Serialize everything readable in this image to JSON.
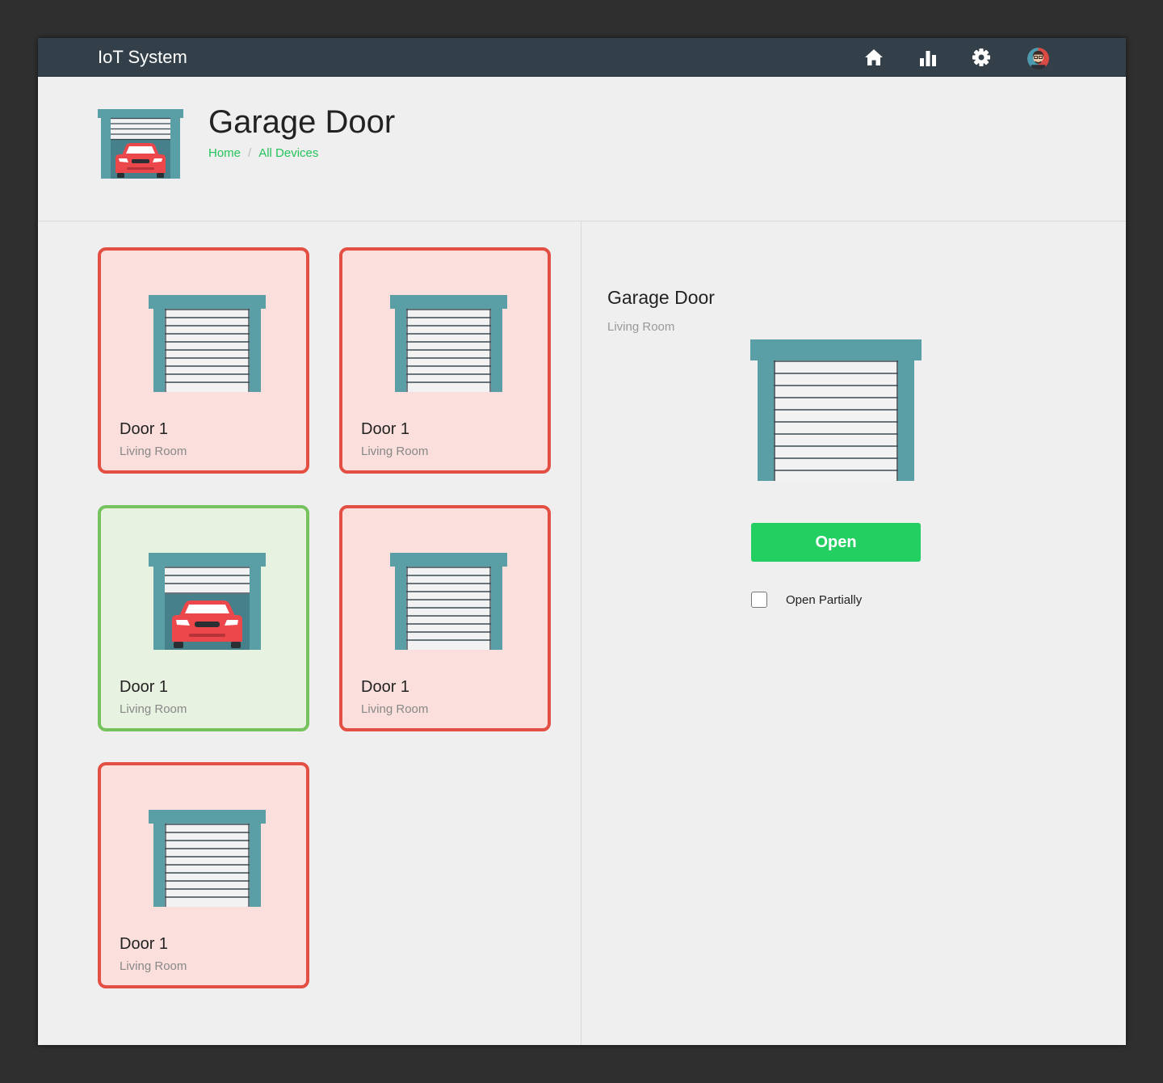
{
  "app": {
    "title": "IoT System"
  },
  "nav": {
    "icons": [
      {
        "name": "home-icon"
      },
      {
        "name": "stats-icon"
      },
      {
        "name": "settings-icon"
      },
      {
        "name": "user-avatar"
      }
    ]
  },
  "header": {
    "icon": "garage-door-car-icon",
    "title": "Garage Door",
    "breadcrumb": [
      "Home",
      "All Devices"
    ],
    "breadcrumb_separator": "/"
  },
  "devices": [
    {
      "name": "Door 1",
      "room": "Living Room",
      "state": "closed"
    },
    {
      "name": "Door 1",
      "room": "Living Room",
      "state": "closed"
    },
    {
      "name": "Door 1",
      "room": "Living Room",
      "state": "open"
    },
    {
      "name": "Door 1",
      "room": "Living Room",
      "state": "closed"
    },
    {
      "name": "Door 1",
      "room": "Living Room",
      "state": "closed"
    }
  ],
  "detail": {
    "title": "Garage Door",
    "room": "Living Room",
    "button_label": "Open",
    "checkbox_label": "Open Partially",
    "checkbox_checked": false
  },
  "colors": {
    "topbar": "#344049",
    "accent_green": "#24cf62",
    "breadcrumb_link": "#25c35c",
    "closed_border": "#e34f42",
    "closed_bg": "#fbdfdc",
    "open_border": "#76c35e",
    "open_bg": "#e8f2e1",
    "garage_frame": "#5a9ea6",
    "car_red": "#ec474a"
  }
}
